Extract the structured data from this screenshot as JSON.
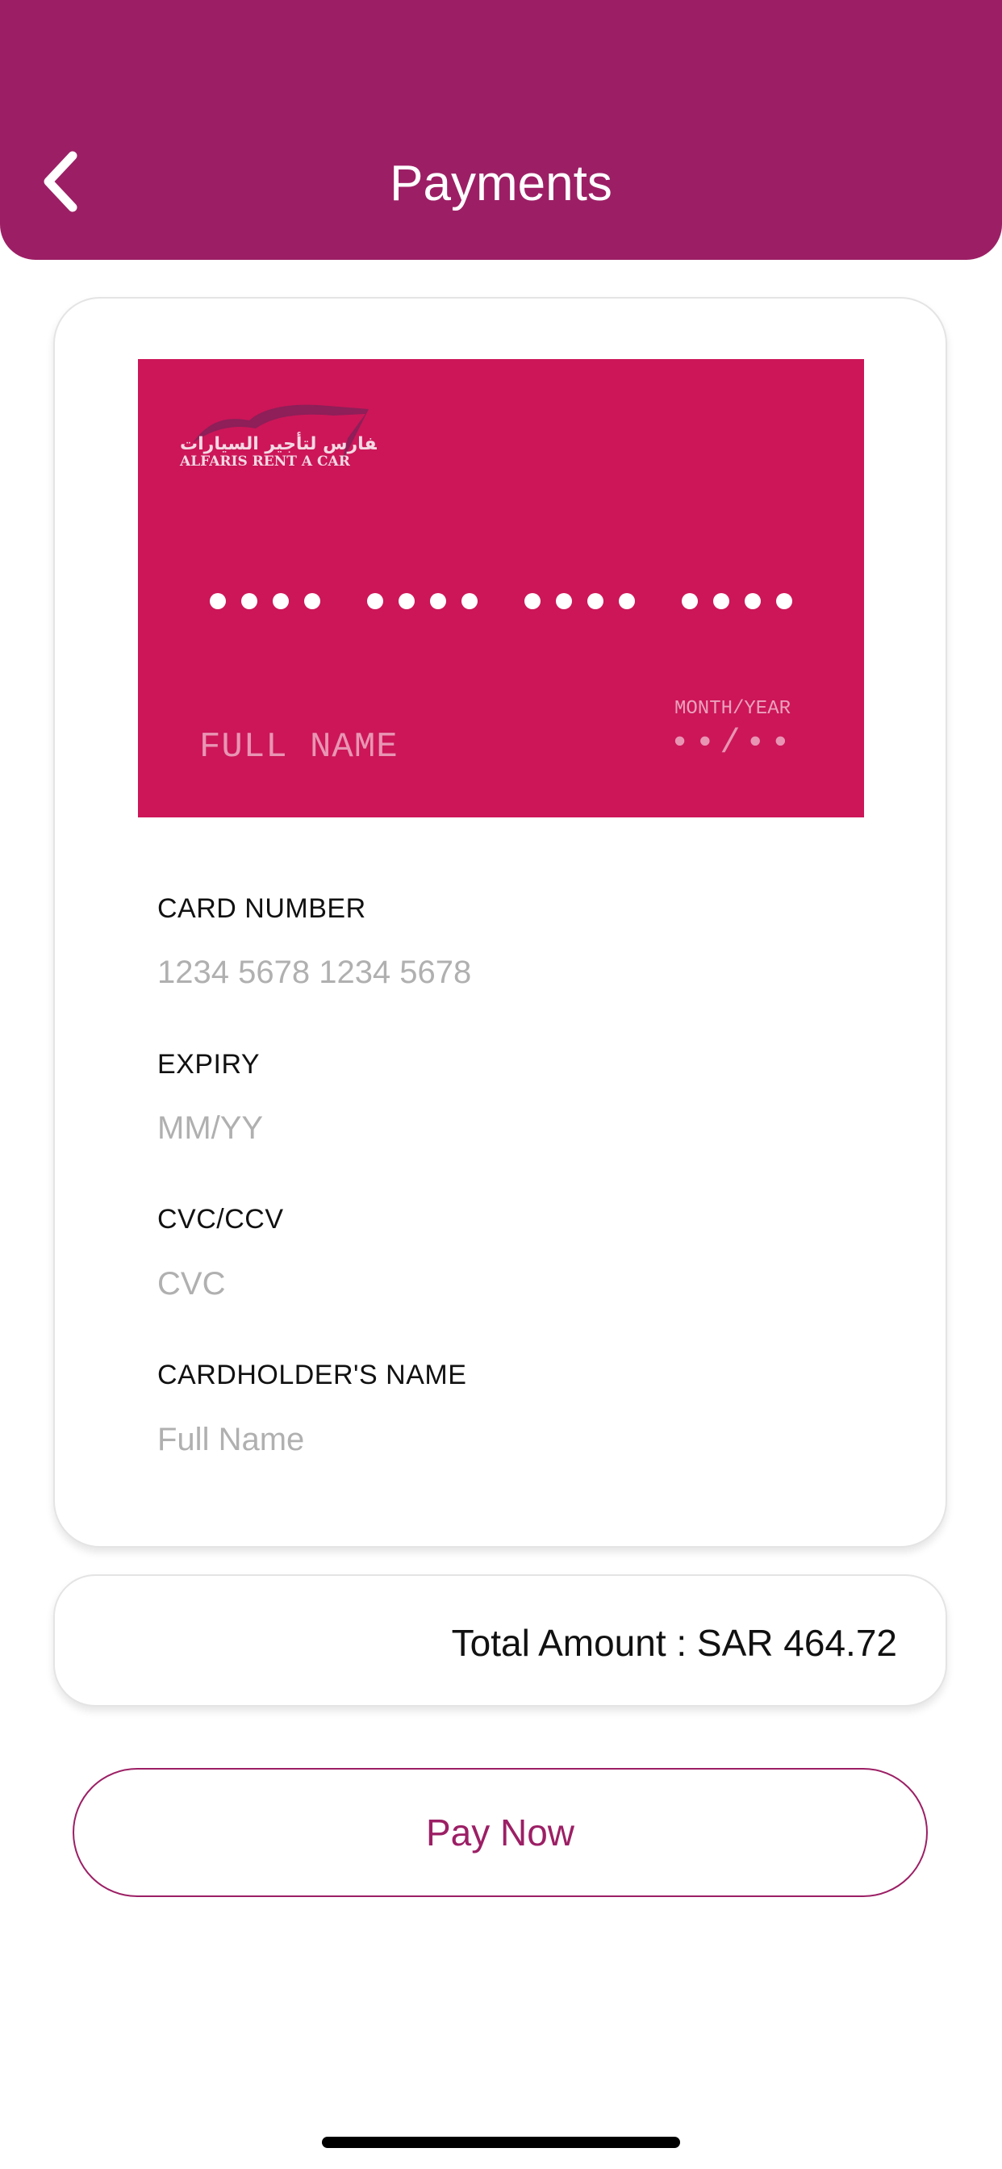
{
  "colors": {
    "brand": "#9c1f65",
    "card": "#cc1658"
  },
  "header": {
    "title": "Payments",
    "back_icon": "chevron-left-icon"
  },
  "card_preview": {
    "logo_arabic": "الفارس لتأجير السيارات",
    "logo_english": "ALFARIS RENT A CAR",
    "number_mask": "•••• •••• •••• ••••",
    "name": "FULL NAME",
    "expiry_label": "MONTH/YEAR",
    "expiry_mask": "••/••"
  },
  "form": {
    "card_number": {
      "label": "CARD NUMBER",
      "placeholder": "1234 5678 1234 5678",
      "value": ""
    },
    "expiry": {
      "label": "EXPIRY",
      "placeholder": "MM/YY",
      "value": ""
    },
    "cvc": {
      "label": "CVC/CCV",
      "placeholder": "CVC",
      "value": ""
    },
    "name": {
      "label": "CARDHOLDER'S NAME",
      "placeholder": "Full Name",
      "value": ""
    }
  },
  "total": {
    "text": "Total Amount : SAR 464.72"
  },
  "pay_button": {
    "label": "Pay Now"
  }
}
